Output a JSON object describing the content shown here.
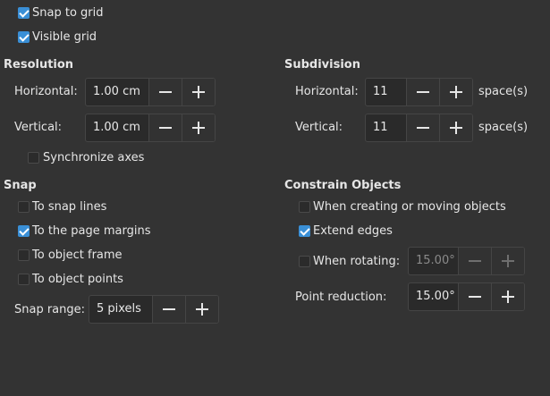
{
  "grid": {
    "snap_to_grid": {
      "label": "Snap to grid",
      "checked": true
    },
    "visible_grid": {
      "label": "Visible grid",
      "checked": true
    }
  },
  "resolution": {
    "heading": "Resolution",
    "horizontal_label": "Horizontal:",
    "horizontal_value": "1.00 cm",
    "vertical_label": "Vertical:",
    "vertical_value": "1.00 cm",
    "synchronize": {
      "label": "Synchronize axes",
      "checked": false
    }
  },
  "subdivision": {
    "heading": "Subdivision",
    "horizontal_label": "Horizontal:",
    "horizontal_value": "11",
    "horizontal_unit": "space(s)",
    "vertical_label": "Vertical:",
    "vertical_value": "11",
    "vertical_unit": "space(s)"
  },
  "snap": {
    "heading": "Snap",
    "snap_lines": {
      "label": "To snap lines",
      "checked": false
    },
    "page_margins": {
      "label": "To the page margins",
      "checked": true
    },
    "object_frame": {
      "label": "To object frame",
      "checked": false
    },
    "object_points": {
      "label": "To object points",
      "checked": false
    },
    "range_label": "Snap range:",
    "range_value": "5 pixels"
  },
  "constrain": {
    "heading": "Constrain Objects",
    "creating_moving": {
      "label": "When creating or moving objects",
      "checked": false
    },
    "extend_edges": {
      "label": "Extend edges",
      "checked": true
    },
    "rotating": {
      "label": "When rotating:",
      "checked": false,
      "value": "15.00°"
    },
    "point_reduction_label": "Point reduction:",
    "point_reduction_value": "15.00°"
  },
  "colors": {
    "accent": "#3a8fd6",
    "background": "#333333"
  }
}
